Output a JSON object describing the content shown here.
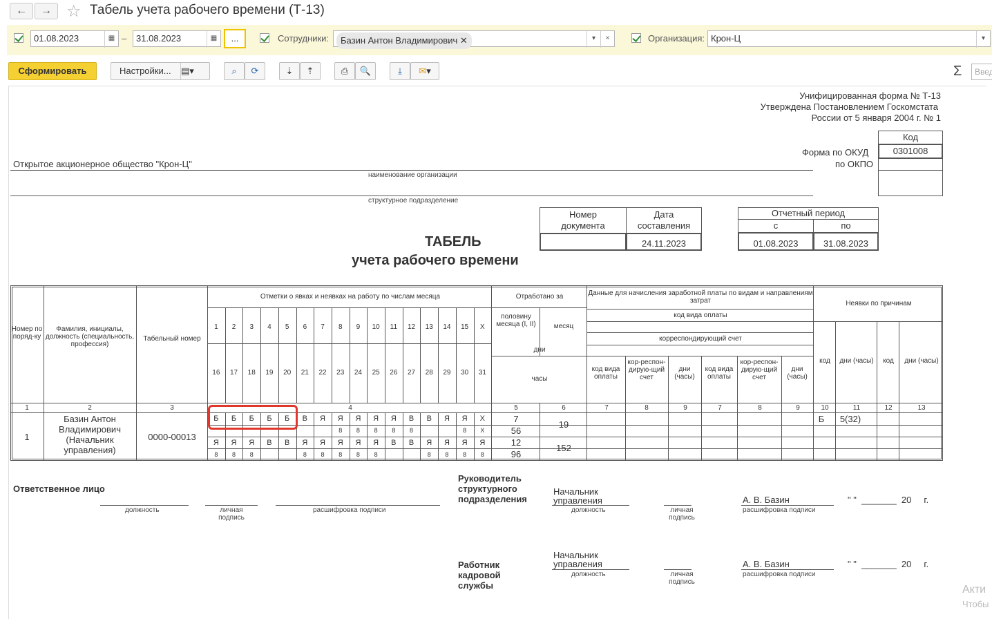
{
  "window": {
    "title": "Табель учета рабочего времени (Т-13)",
    "back_glyph": "←",
    "forward_glyph": "→",
    "star_glyph": "☆"
  },
  "filter": {
    "date_from": "01.08.2023",
    "dash": "–",
    "date_to": "31.08.2023",
    "more_button": "...",
    "employees_label": "Сотрудники:",
    "employee_tag": "Базин Антон Владимирович",
    "tag_close": "✕",
    "dropdown_glyph": "▾",
    "clear_glyph": "×",
    "org_label": "Организация:",
    "org_value": "Крон-Ц"
  },
  "toolbar": {
    "generate": "Сформировать",
    "settings": "Настройки...",
    "sigma": "Σ",
    "search_placeholder": "Введ"
  },
  "colors": {
    "accent": "#f5d033",
    "filter_bg": "#fbf7d9",
    "check": "#2f8f2f",
    "highlight": "#e0372c"
  },
  "header": {
    "unified_form": "Унифицированная форма № Т-13",
    "approved_1": "Утверждена Постановлением Госкомстата",
    "approved_2": "России от 5 января 2004 г. № 1",
    "code_label": "Код",
    "okud_label": "Форма по ОКУД",
    "okud_value": "0301008",
    "okpo_label": "по ОКПО",
    "org_name": "Открытое акционерное общество \"Крон-Ц\"",
    "org_caption": "наименование организации",
    "dept_caption": "структурное подразделение",
    "doc_number_label": "Номер документа",
    "doc_date_label": "Дата составления",
    "doc_date_value": "24.11.2023",
    "period_label": "Отчетный период",
    "period_from_label": "с",
    "period_to_label": "по",
    "period_from": "01.08.2023",
    "period_to": "31.08.2023",
    "title_1": "ТАБЕЛЬ",
    "title_2": "учета  рабочего времени"
  },
  "table": {
    "h_num": "Номер по поряд-ку",
    "h_name": "Фамилия, инициалы, должность (специальность, профессия)",
    "h_tab": "Табельный номер",
    "h_marks": "Отметки о явках и неявках на работу по числам месяца",
    "days_top": [
      "1",
      "2",
      "3",
      "4",
      "5",
      "6",
      "7",
      "8",
      "9",
      "10",
      "11",
      "12",
      "13",
      "14",
      "15",
      "X"
    ],
    "days_bottom": [
      "16",
      "17",
      "18",
      "19",
      "20",
      "21",
      "22",
      "23",
      "24",
      "25",
      "26",
      "27",
      "28",
      "29",
      "30",
      "31"
    ],
    "h_worked": "Отработано за",
    "h_half": "половину месяца (I, II)",
    "h_month": "месяц",
    "h_days": "дни",
    "h_hours": "часы",
    "h_pay": "Данные для начисления заработной платы по видам и направлениям затрат",
    "h_paycode": "код вида оплаты",
    "h_account": "корреспондирующий счет",
    "h_paycode_short": "код вида оплаты",
    "h_corr": "кор-респон-дирую-щий счет",
    "h_dayshours": "дни (часы)",
    "h_absence": "Неявки по причинам",
    "h_code": "код",
    "col_numbers": [
      "1",
      "2",
      "3",
      "4",
      "5",
      "6",
      "7",
      "8",
      "9",
      "7",
      "8",
      "9",
      "10",
      "11",
      "12",
      "13"
    ],
    "row": {
      "num": "1",
      "name": "Базин Антон Владимирович (Начальник управления)",
      "tab": "0000-00013",
      "marks_1": [
        "Б",
        "Б",
        "Б",
        "Б",
        "Б",
        "В",
        "Я",
        "Я",
        "Я",
        "Я",
        "Я",
        "В",
        "В",
        "Я",
        "Я",
        "Х"
      ],
      "hours_1": [
        "",
        "",
        "",
        "",
        "",
        "",
        "",
        "8",
        "8",
        "8",
        "8",
        "8",
        "",
        "",
        "8",
        "8",
        "Х"
      ],
      "marks_2": [
        "Я",
        "Я",
        "Я",
        "В",
        "В",
        "Я",
        "Я",
        "Я",
        "Я",
        "Я",
        "В",
        "В",
        "Я",
        "Я",
        "Я",
        "Я"
      ],
      "hours_2": [
        "8",
        "8",
        "8",
        "",
        "",
        "8",
        "8",
        "8",
        "8",
        "8",
        "",
        "",
        "8",
        "8",
        "8",
        "8"
      ],
      "half1_days": "7",
      "half1_hours": "56",
      "half2_days": "12",
      "half2_hours": "96",
      "month_days": "19",
      "month_hours": "152",
      "abs_code": "Б",
      "abs_days": "5(32)"
    }
  },
  "signatures": {
    "responsible": "Ответственное лицо",
    "position": "должность",
    "signature": "личная подпись",
    "decode": "расшифровка подписи",
    "head": "Руководитель структурного подразделения",
    "head_position": "Начальник управления",
    "head_name": "А. В. Базин",
    "date_tmpl": "\" \"  _______  20     г.",
    "hr": "Работник кадровой службы",
    "hr_position": "Начальник управления",
    "hr_name": "А. В. Базин"
  },
  "watermark": {
    "line1": "Акти",
    "line2": "Чтобы"
  }
}
